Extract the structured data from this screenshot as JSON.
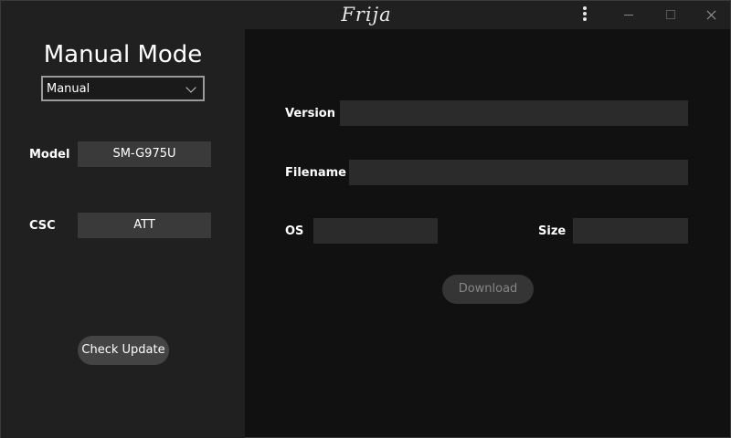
{
  "window": {
    "title": "Frija"
  },
  "sidebar": {
    "heading": "Manual Mode",
    "mode_select": {
      "value": "Manual"
    },
    "model": {
      "label": "Model",
      "value": "SM-G975U"
    },
    "csc": {
      "label": "CSC",
      "value": "ATT"
    },
    "check_update_label": "Check Update"
  },
  "main": {
    "version_label": "Version",
    "version_value": "",
    "filename_label": "Filename",
    "filename_value": "",
    "os_label": "OS",
    "os_value": "",
    "size_label": "Size",
    "size_value": "",
    "download_label": "Download"
  },
  "icons": [
    "more-vert-icon",
    "minimize-icon",
    "maximize-icon",
    "close-icon",
    "chevron-down-icon"
  ]
}
